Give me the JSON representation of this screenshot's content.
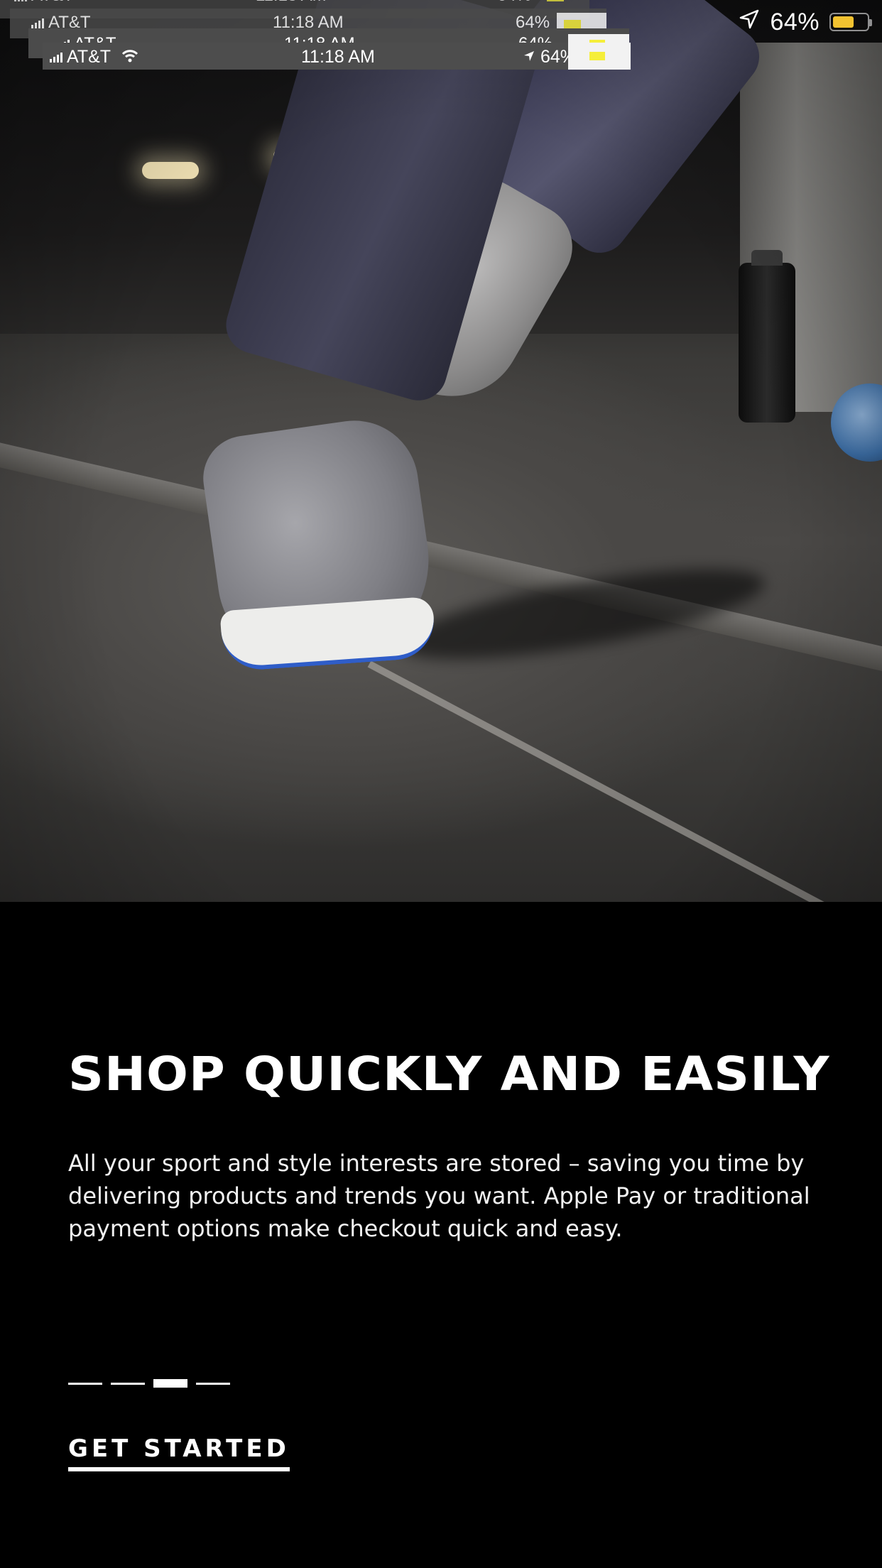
{
  "status_bar": {
    "carrier": "AT&T",
    "time": "11:18 AM",
    "battery_percent": "64%",
    "battery_level": 0.64,
    "battery_color": "#f2c230",
    "icons": [
      "signal-icon",
      "wifi-icon",
      "location-arrow-icon",
      "battery-icon"
    ]
  },
  "hero": {
    "image": "running-shoe-photo"
  },
  "onboarding": {
    "title": "SHOP QUICKLY AND EASILY",
    "description": "All your sport and style interests are stored – saving you time by delivering products and trends you want. Apple Pay or traditional payment options make checkout quick and easy.",
    "page_count": 4,
    "active_page": 3,
    "cta_label": "GET STARTED"
  },
  "colors": {
    "background": "#000000",
    "text": "#ffffff",
    "accent_yellow": "#f2c230"
  }
}
